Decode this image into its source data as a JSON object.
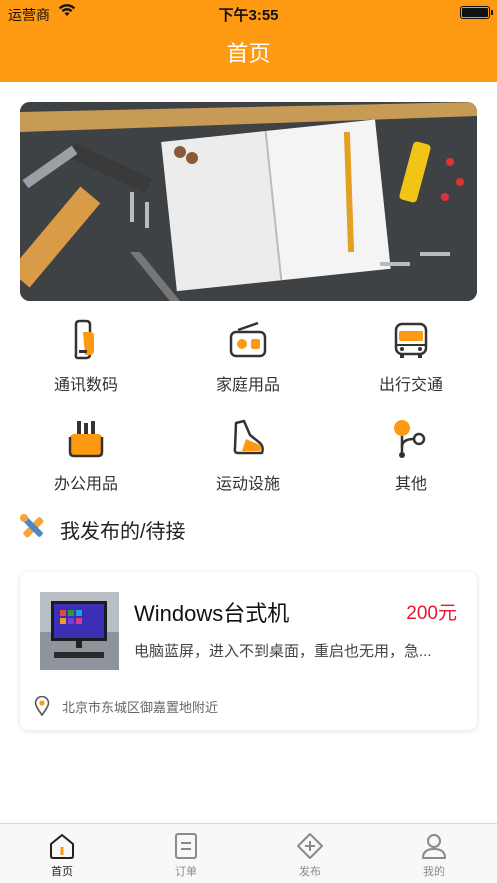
{
  "status_bar": {
    "carrier": "运营商",
    "time": "下午3:55"
  },
  "header": {
    "title": "首页"
  },
  "categories": [
    {
      "label": "通讯数码",
      "icon": "phone-icon"
    },
    {
      "label": "家庭用品",
      "icon": "radio-icon"
    },
    {
      "label": "出行交通",
      "icon": "bus-icon"
    },
    {
      "label": "办公用品",
      "icon": "pen-holder-icon"
    },
    {
      "label": "运动设施",
      "icon": "shoe-icon"
    },
    {
      "label": "其他",
      "icon": "share-nodes-icon"
    }
  ],
  "section": {
    "title": "我发布的/待接"
  },
  "listing": {
    "title": "Windows台式机",
    "price": "200元",
    "description": "电脑蓝屏，进入不到桌面，重启也无用，急...",
    "location": "北京市东城区御嘉置地附近"
  },
  "tabbar": {
    "items": [
      {
        "label": "首页",
        "icon": "home-icon",
        "active": true
      },
      {
        "label": "订单",
        "icon": "order-icon",
        "active": false
      },
      {
        "label": "发布",
        "icon": "publish-icon",
        "active": false
      },
      {
        "label": "我的",
        "icon": "profile-icon",
        "active": false
      }
    ]
  },
  "colors": {
    "accent": "#fd9a12",
    "price": "#e8152b"
  }
}
